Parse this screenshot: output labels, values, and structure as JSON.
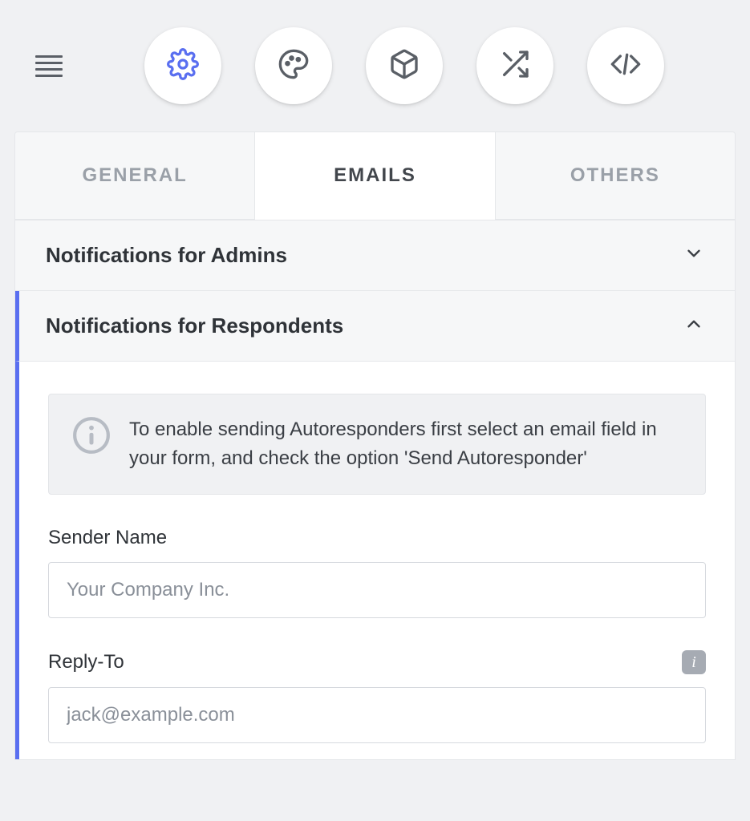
{
  "toolbar": {
    "icon_buttons": [
      {
        "name": "gear-icon",
        "active": true
      },
      {
        "name": "palette-icon",
        "active": false
      },
      {
        "name": "cube-icon",
        "active": false
      },
      {
        "name": "shuffle-icon",
        "active": false
      },
      {
        "name": "code-icon",
        "active": false
      }
    ]
  },
  "tabs": [
    {
      "label": "GENERAL",
      "active": false
    },
    {
      "label": "EMAILS",
      "active": true
    },
    {
      "label": "OTHERS",
      "active": false
    }
  ],
  "sections": {
    "admins": {
      "title": "Notifications for Admins",
      "expanded": false
    },
    "respondents": {
      "title": "Notifications for Respondents",
      "expanded": true,
      "info_text": "To enable sending Autoresponders first select an email field in your form, and check the option 'Send Autoresponder'",
      "fields": {
        "sender_name": {
          "label": "Sender Name",
          "placeholder": "Your Company Inc.",
          "value": ""
        },
        "reply_to": {
          "label": "Reply-To",
          "placeholder": "jack@example.com",
          "value": ""
        }
      }
    }
  }
}
